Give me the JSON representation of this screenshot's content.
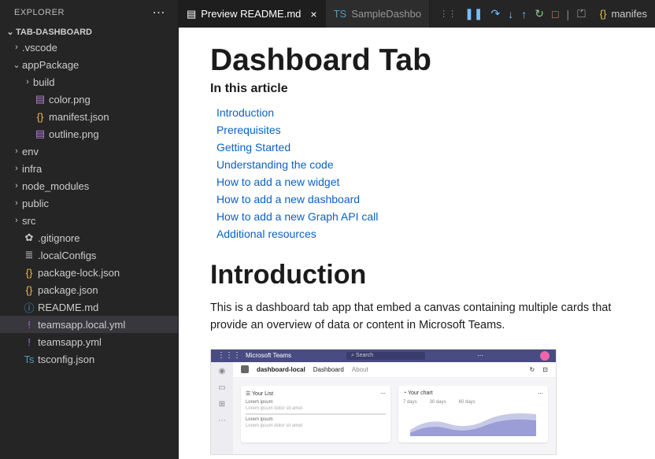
{
  "sidebar": {
    "title": "EXPLORER",
    "project": "TAB-DASHBOARD",
    "tree": [
      {
        "type": "folder",
        "label": ".vscode",
        "indent": 0,
        "open": false
      },
      {
        "type": "folder",
        "label": "appPackage",
        "indent": 0,
        "open": true
      },
      {
        "type": "folder",
        "label": "build",
        "indent": 1,
        "open": false
      },
      {
        "type": "file",
        "label": "color.png",
        "indent": 1,
        "icon": "img"
      },
      {
        "type": "file",
        "label": "manifest.json",
        "indent": 1,
        "icon": "json"
      },
      {
        "type": "file",
        "label": "outline.png",
        "indent": 1,
        "icon": "img"
      },
      {
        "type": "folder",
        "label": "env",
        "indent": 0,
        "open": false
      },
      {
        "type": "folder",
        "label": "infra",
        "indent": 0,
        "open": false
      },
      {
        "type": "folder",
        "label": "node_modules",
        "indent": 0,
        "open": false
      },
      {
        "type": "folder",
        "label": "public",
        "indent": 0,
        "open": false
      },
      {
        "type": "folder",
        "label": "src",
        "indent": 0,
        "open": false
      },
      {
        "type": "file",
        "label": ".gitignore",
        "indent": 0,
        "icon": "gear"
      },
      {
        "type": "file",
        "label": ".localConfigs",
        "indent": 0,
        "icon": "lines"
      },
      {
        "type": "file",
        "label": "package-lock.json",
        "indent": 0,
        "icon": "json"
      },
      {
        "type": "file",
        "label": "package.json",
        "indent": 0,
        "icon": "json"
      },
      {
        "type": "file",
        "label": "README.md",
        "indent": 0,
        "icon": "info"
      },
      {
        "type": "file",
        "label": "teamsapp.local.yml",
        "indent": 0,
        "icon": "yaml",
        "selected": true
      },
      {
        "type": "file",
        "label": "teamsapp.yml",
        "indent": 0,
        "icon": "yaml"
      },
      {
        "type": "file",
        "label": "tsconfig.json",
        "indent": 0,
        "icon": "ts"
      }
    ]
  },
  "tabs": {
    "tab1": {
      "icon": "preview",
      "label": "Preview README.md",
      "active": true
    },
    "tab2": {
      "prefix": "TS",
      "label": "SampleDashbo"
    },
    "overflow": {
      "label": "manifes"
    }
  },
  "preview": {
    "h1": "Dashboard Tab",
    "sub": "In this article",
    "toc": [
      "Introduction",
      "Prerequisites",
      "Getting Started",
      "Understanding the code",
      "How to add a new widget",
      "How to add a new dashboard",
      "How to add a new Graph API call",
      "Additional resources"
    ],
    "section": "Introduction",
    "para": "This is a dashboard tab app that embed a canvas containing multiple cards that provide an overview of data or content in Microsoft Teams.",
    "teams": {
      "brand": "Microsoft Teams",
      "search": "Search",
      "app": "dashboard-local",
      "tab1": "Dashboard",
      "tab2": "About",
      "card1_title": "Your List",
      "card1_l1": "Lorem ipsum",
      "card1_l2": "Lorem ipsum dolor sit amet",
      "card1_l3": "Lorem ipsum",
      "card2_title": "Your chart",
      "card2_t1": "7 days",
      "card2_t2": "30 days",
      "card2_t3": "60 days"
    }
  }
}
